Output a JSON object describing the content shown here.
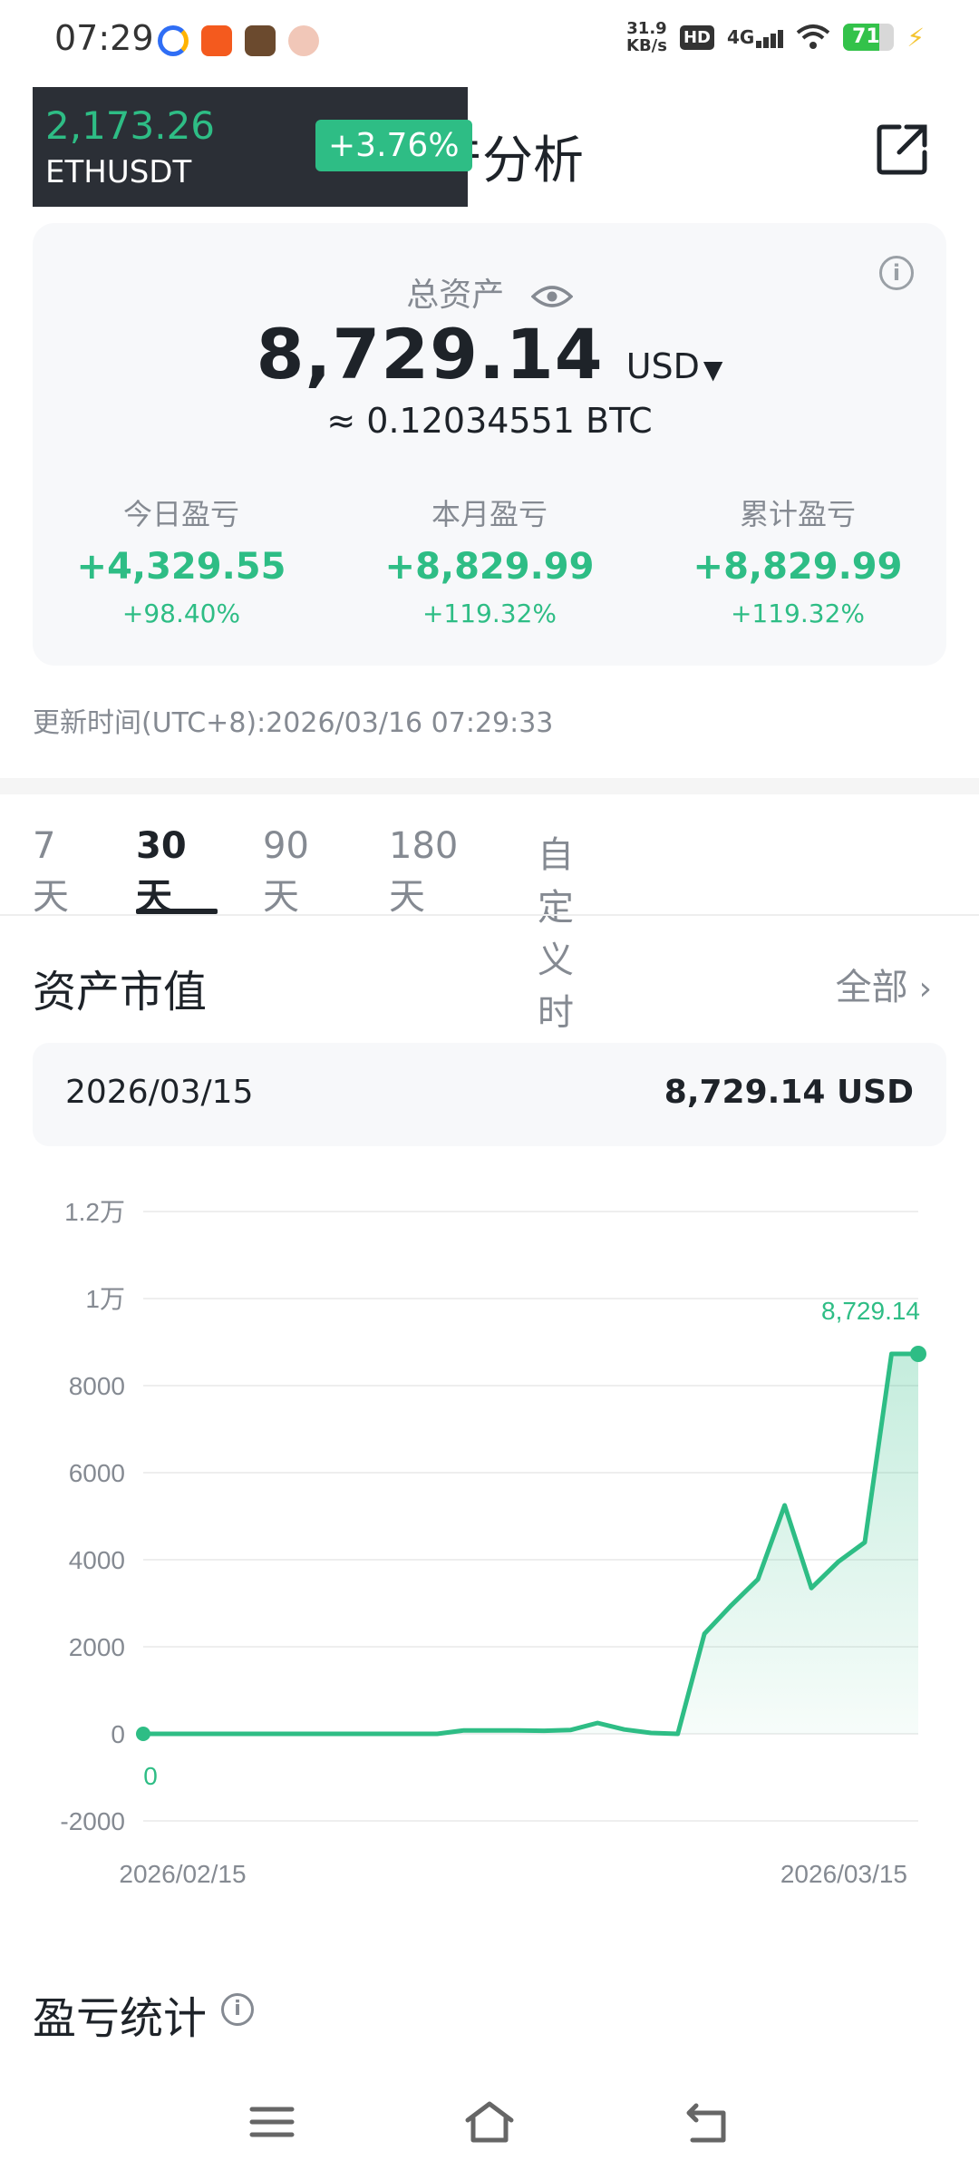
{
  "status_bar": {
    "time": "07:29",
    "net_speed_value": "31.9",
    "net_speed_unit": "KB/s",
    "hd_label": "HD",
    "network_label": "4G",
    "battery_level": "71"
  },
  "header": {
    "title": "资产分析"
  },
  "ticker": {
    "price": "2,173.26",
    "symbol": "ETHUSDT",
    "change": "+3.76%"
  },
  "asset_card": {
    "total_label": "总资产",
    "total_value": "8,729.14",
    "currency": "USD",
    "btc_equiv": "≈ 0.12034551 BTC",
    "pnl": [
      {
        "label": "今日盈亏",
        "value": "+4,329.55",
        "pct": "+98.40%"
      },
      {
        "label": "本月盈亏",
        "value": "+8,829.99",
        "pct": "+119.32%"
      },
      {
        "label": "累计盈亏",
        "value": "+8,829.99",
        "pct": "+119.32%"
      }
    ]
  },
  "update_time": "更新时间(UTC+8):2026/03/16 07:29:33",
  "tabs": [
    "7天",
    "30天",
    "90天",
    "180天",
    "自定义时间"
  ],
  "active_tab": "30天",
  "market_value": {
    "title": "资产市值",
    "all_label": "全部",
    "selected_date": "2026/03/15",
    "selected_value": "8,729.14 USD"
  },
  "chart_data": {
    "type": "area",
    "y_ticks": [
      "1.2万",
      "1万",
      "8000",
      "6000",
      "4000",
      "2000",
      "0",
      "-2000"
    ],
    "ylim": [
      -2000,
      12000
    ],
    "x_tick_labels": [
      "2026/02/15",
      "2026/03/15"
    ],
    "x": [
      "2026/02/14",
      "2026/02/15",
      "2026/02/16",
      "2026/02/17",
      "2026/02/18",
      "2026/02/19",
      "2026/02/20",
      "2026/02/21",
      "2026/02/22",
      "2026/02/23",
      "2026/02/24",
      "2026/02/25",
      "2026/02/26",
      "2026/02/27",
      "2026/02/28",
      "2026/03/01",
      "2026/03/02",
      "2026/03/03",
      "2026/03/04",
      "2026/03/05",
      "2026/03/06",
      "2026/03/07",
      "2026/03/08",
      "2026/03/09",
      "2026/03/10",
      "2026/03/11",
      "2026/03/12",
      "2026/03/13",
      "2026/03/14",
      "2026/03/15"
    ],
    "values": [
      0,
      0,
      0,
      0,
      0,
      0,
      0,
      0,
      0,
      0,
      0,
      0,
      80,
      80,
      80,
      70,
      90,
      250,
      100,
      20,
      0,
      2300,
      2950,
      3550,
      5250,
      3350,
      3950,
      4400,
      8729.14,
      8729.14
    ],
    "start_label": "0",
    "end_label": "8,729.14",
    "line_color": "#2ebd85"
  },
  "pnl_section": {
    "title": "盈亏统计"
  }
}
